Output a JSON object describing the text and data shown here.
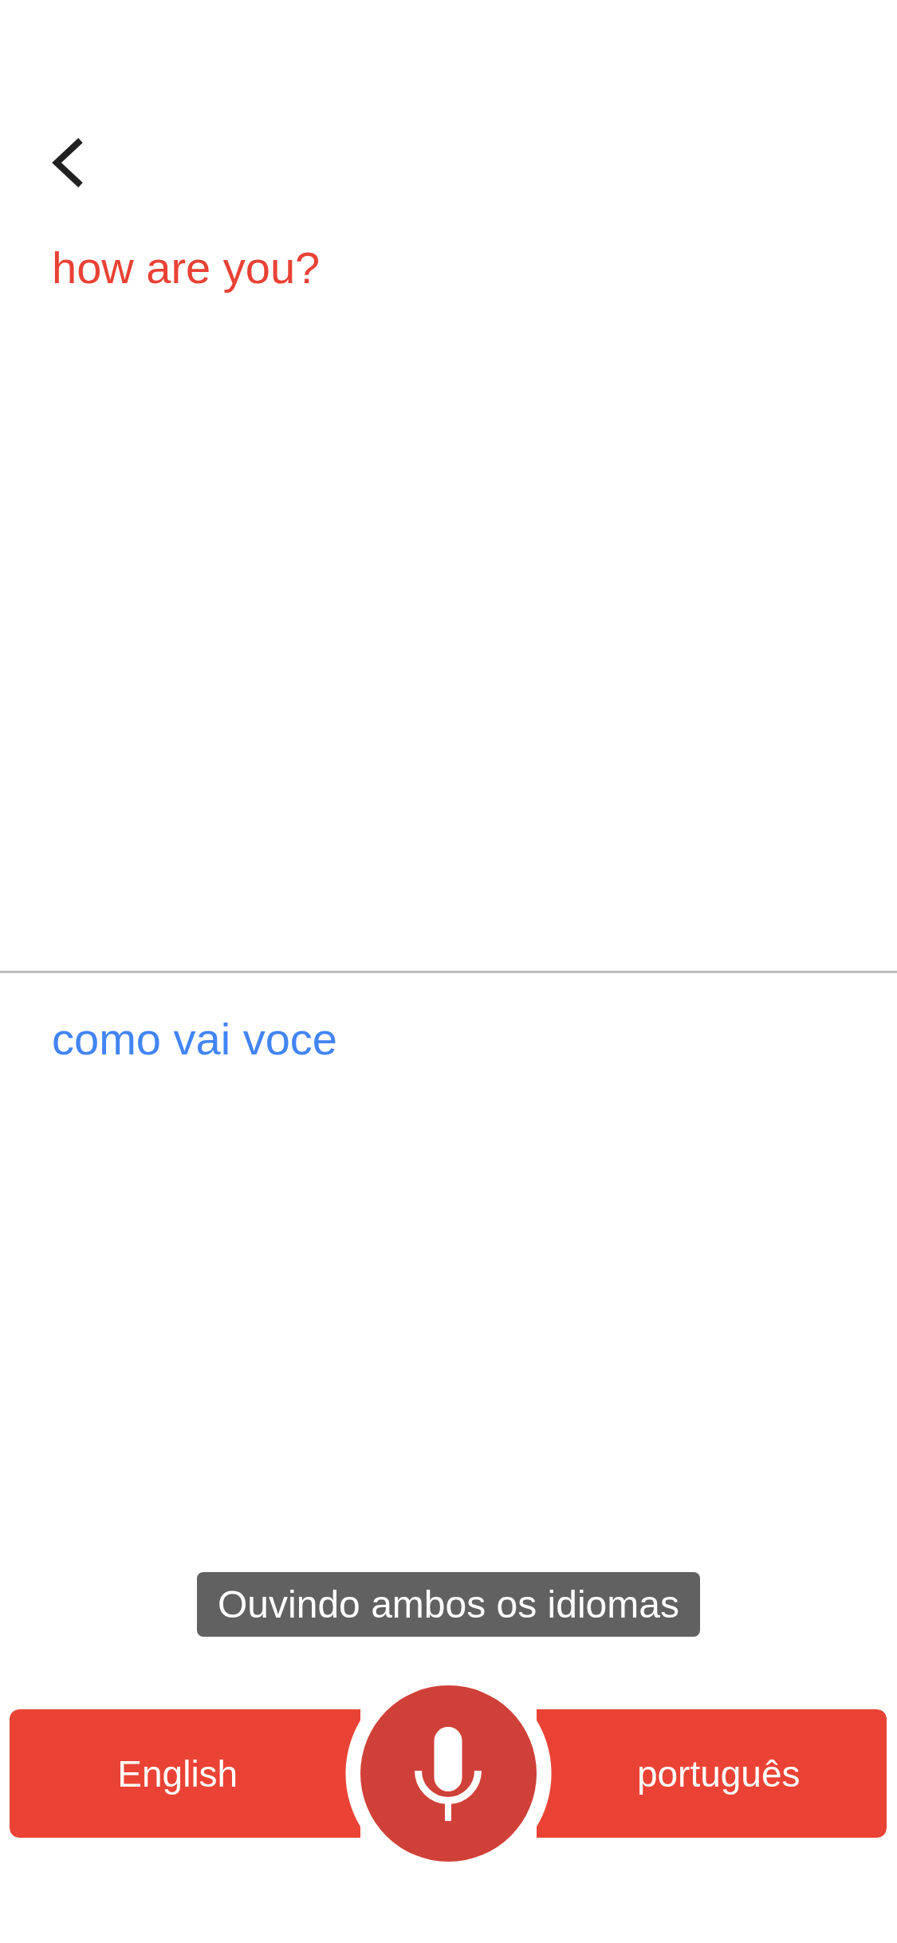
{
  "source": {
    "text": "how are you?"
  },
  "translation": {
    "text": "como vai voce"
  },
  "status_tooltip": {
    "text": "Ouvindo ambos os idiomas"
  },
  "languages": [
    {
      "label": "English"
    },
    {
      "label": "português"
    }
  ]
}
